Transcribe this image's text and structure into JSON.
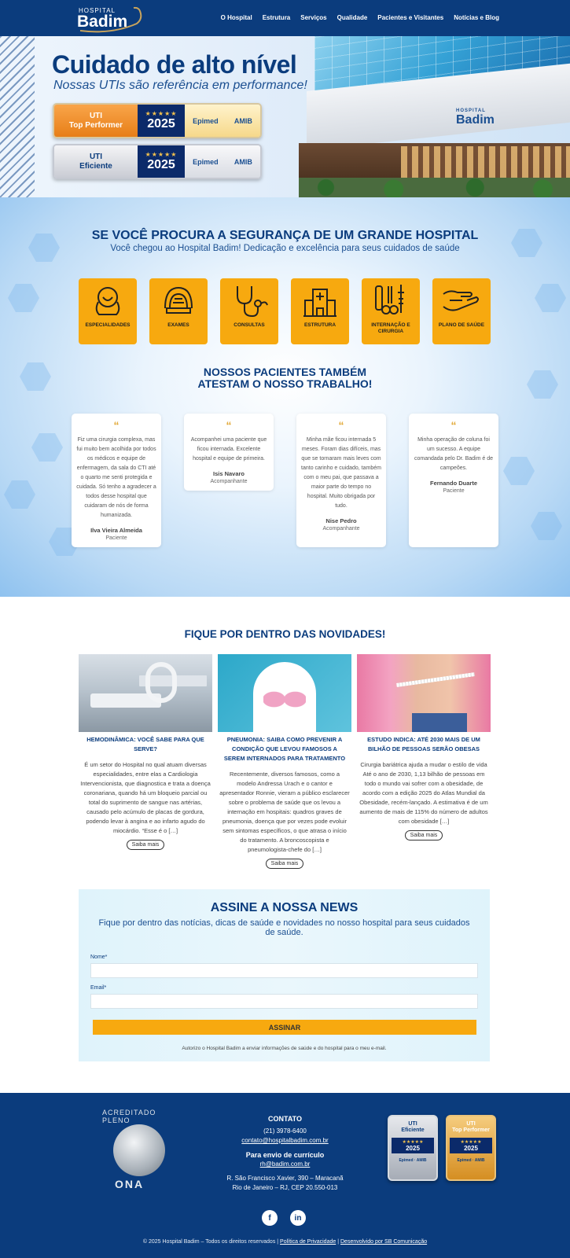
{
  "header": {
    "logo_small": "HOSPITAL",
    "logo_big": "Badim",
    "nav": [
      "O Hospital",
      "Estrutura",
      "Serviços",
      "Qualidade",
      "Pacientes e Visitantes",
      "Notícias e Blog"
    ]
  },
  "hero": {
    "title": "Cuidado de alto nível",
    "subtitle": "Nossas UTIs são referência em performance!",
    "badges": [
      {
        "line1": "UTI",
        "line2": "Top Performer",
        "stars": "★★★★★",
        "year": "2025",
        "logo1": "Epimed",
        "logo2": "AMIB"
      },
      {
        "line1": "UTI",
        "line2": "Eficiente",
        "stars": "★★★★★",
        "year": "2025",
        "logo1": "Epimed",
        "logo2": "AMIB"
      }
    ],
    "building_sign_small": "HOSPITAL",
    "building_sign": "Badim"
  },
  "intro": {
    "title": "SE VOCÊ PROCURA A SEGURANÇA DE UM GRANDE HOSPITAL",
    "subtitle": "Você chegou ao Hospital Badim! Dedicação e excelência para seus cuidados de saúde"
  },
  "services": [
    {
      "label": "ESPECIALIDADES",
      "icon": "specialties-icon"
    },
    {
      "label": "EXAMES",
      "icon": "exams-icon"
    },
    {
      "label": "CONSULTAS",
      "icon": "stethoscope-icon"
    },
    {
      "label": "ESTRUTURA",
      "icon": "hospital-building-icon"
    },
    {
      "label": "INTERNAÇÃO E CIRURGIA",
      "icon": "surgery-icon"
    },
    {
      "label": "PLANO DE SAÚDE",
      "icon": "health-plan-icon"
    }
  ],
  "patients": {
    "title_line1": "NOSSOS PACIENTES TAMBÉM",
    "title_line2": "ATESTAM O NOSSO TRABALHO!",
    "quote_mark": "“",
    "testimonials": [
      {
        "text": "Fiz uma cirurgia complexa, mas fui muito bem acolhida por todos os médicos e equipe de enfermagem, da sala do CTI até o quarto me senti protegida e cuidada. Só tenho a agradecer a todos desse hospital que cuidaram de nós de forma humanizada.",
        "name": "Ilva Vieira Almeida",
        "role": "Paciente"
      },
      {
        "text": "Acompanhei uma paciente que ficou internada. Excelente hospital e equipe de primeira.",
        "name": "Isis Navaro",
        "role": "Acompanhante"
      },
      {
        "text": "Minha mãe ficou internada 5 meses. Foram dias difíceis, mas que se tornaram mais leves com tanto carinho e cuidado, também com o meu pai, que passava a maior parte do tempo no hospital. Muito obrigada por tudo.",
        "name": "Nise Pedro",
        "role": "Acompanhante"
      },
      {
        "text": "Minha operação de coluna foi um sucesso. A equipe comandada pelo Dr. Badim é de campeões.",
        "name": "Fernando Duarte",
        "role": "Paciente"
      }
    ]
  },
  "news": {
    "title": "FIQUE POR DENTRO DAS NOVIDADES!",
    "read_more": "Saiba mais",
    "articles": [
      {
        "title": "HEMODINÂMICA: VOCÊ SABE PARA QUE SERVE?",
        "text": "É um setor do Hospital no qual atuam diversas especialidades, entre elas a Cardiologia Intervencionista, que diagnostica e trata a doença coronariana, quando há um bloqueio parcial ou total do suprimento de sangue nas artérias, causado pelo acúmulo de placas de gordura, podendo levar à angina e ao infarto agudo do miocárdio. “Esse é o […]"
      },
      {
        "title": "PNEUMONIA: SAIBA COMO PREVENIR A CONDIÇÃO QUE LEVOU FAMOSOS A SEREM INTERNADOS PARA TRATAMENTO",
        "text": "Recentemente, diversos famosos, como a modelo Andressa Urach e o cantor e apresentador Ronnie, vieram a público esclarecer sobre o problema de saúde que os levou a internação em hospitais: quadros graves de pneumonia, doença que por vezes pode evoluir sem sintomas específicos, o que atrasa o início do tratamento. A broncoscopista e pneumologista-chefe do […]"
      },
      {
        "title": "ESTUDO INDICA: ATÉ 2030 MAIS DE UM BILHÃO DE PESSOAS SERÃO OBESAS",
        "text": "Cirurgia bariátrica ajuda a mudar o estilo de vida Até o ano de 2030, 1,13 bilhão de pessoas em todo o mundo vai sofrer com a obesidade, de acordo com a edição 2025 do Atlas Mundial da Obesidade, recém-lançado. A estimativa é de um aumento de mais de 115% do número de adultos com obesidade […]"
      }
    ]
  },
  "newsletter": {
    "title": "ASSINE A NOSSA NEWS",
    "subtitle": "Fique por dentro das notícias, dicas de saúde e novidades no nosso hospital para seus cuidados de saúde.",
    "name_label": "Nome*",
    "email_label": "Email*",
    "submit": "ASSINAR",
    "consent": "Autorizo o Hospital Badim a enviar informações de saúde e do hospital para o meu e-mail."
  },
  "footer": {
    "ona_curve": "ACREDITADO PLENO",
    "ona_text": "ONA",
    "contact_title": "CONTATO",
    "phone": "(21) 3978-6400",
    "email": "contato@hospitalbadim.com.br",
    "cv_title": "Para envio de currículo",
    "cv_email": "rh@badim.com.br",
    "address1": "R. São Francisco Xavier, 390 – Maracanã",
    "address2": "Rio de Janeiro – RJ, CEP 20.550-013",
    "seals": [
      {
        "line1": "UTI",
        "line2": "Eficiente",
        "stars": "★★★★★",
        "year": "2025",
        "logos": "Epimed · AMIB"
      },
      {
        "line1": "UTI",
        "line2": "Top Performer",
        "stars": "★★★★★",
        "year": "2025",
        "logos": "Epimed · AMIB"
      }
    ],
    "social": [
      "f",
      "in"
    ],
    "copyright": "© 2025 Hospital Badim – Todos os direitos reservados |",
    "privacy": "Política de Privacidade",
    "separator": "|",
    "developer": "Desenvolvido por SB Comunicação"
  },
  "colors": {
    "primary": "#0b3c7d",
    "accent": "#f7a90f",
    "quote": "#e0a32a"
  }
}
